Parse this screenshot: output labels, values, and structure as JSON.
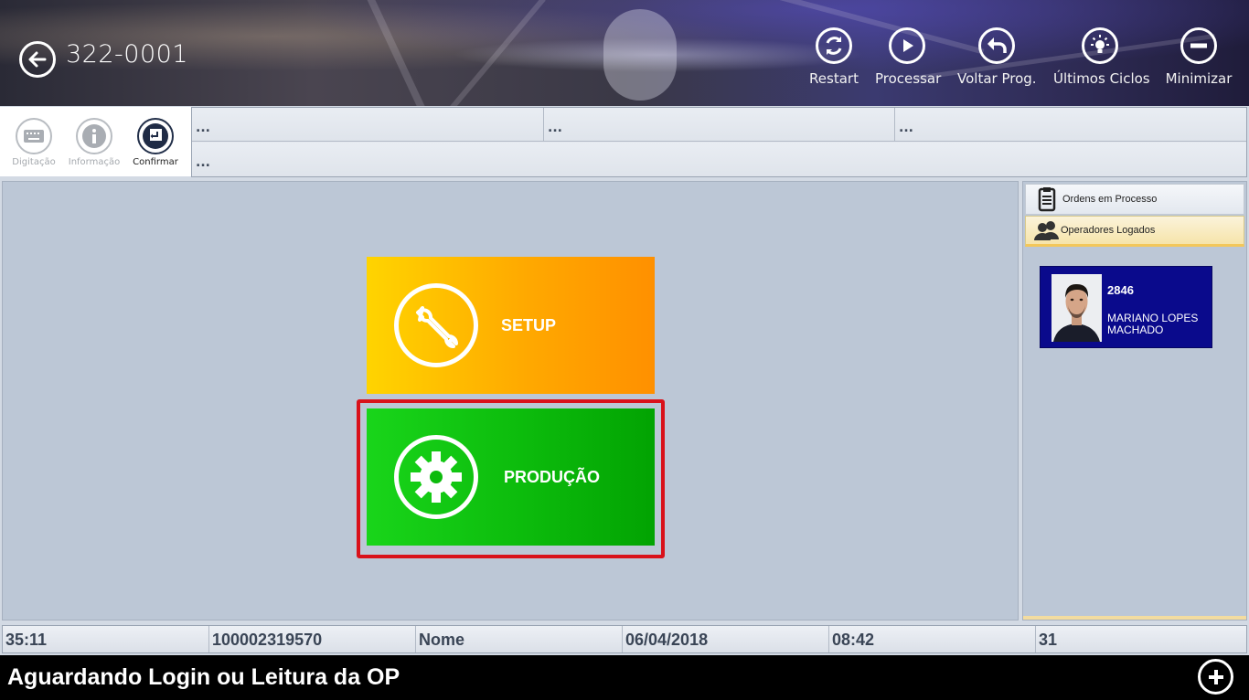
{
  "header": {
    "title": "322-0001",
    "actions": [
      {
        "label": "Restart",
        "icon": "restart-icon"
      },
      {
        "label": "Processar",
        "icon": "play-icon"
      },
      {
        "label": "Voltar Prog.",
        "icon": "undo-icon"
      },
      {
        "label": "Últimos Ciclos",
        "icon": "lightbulb-icon"
      },
      {
        "label": "Minimizar",
        "icon": "minus-icon"
      }
    ]
  },
  "sidetools": [
    {
      "label": "Digitação",
      "icon": "keyboard-icon",
      "enabled": false
    },
    {
      "label": "Informação",
      "icon": "info-icon",
      "enabled": false
    },
    {
      "label": "Confirmar",
      "icon": "enter-icon",
      "enabled": true
    }
  ],
  "info_cells": {
    "row1": [
      "...",
      "...",
      "..."
    ],
    "row2": [
      "..."
    ]
  },
  "tiles": {
    "setup": {
      "label": "SETUP",
      "color_start": "#ffd400",
      "color_end": "#ff9000"
    },
    "production": {
      "label": "PRODUÇÃO",
      "color_start": "#19d51a",
      "color_end": "#02a302",
      "selected": true,
      "selection_color": "#d9111a"
    }
  },
  "right_panel": {
    "tabs": [
      {
        "label": "Ordens em Processo",
        "icon": "clipboard-icon"
      },
      {
        "label": "Operadores Logados",
        "icon": "users-icon",
        "active": true
      }
    ],
    "operator": {
      "id": "2846",
      "name": "MARIANO LOPES MACHADO",
      "card_color": "#0a0a8c"
    }
  },
  "status": {
    "cells": [
      "35:11",
      "100002319570",
      "Nome",
      "06/04/2018",
      "08:42",
      "31"
    ]
  },
  "message_bar": {
    "text": "Aguardando Login ou Leitura da OP"
  }
}
